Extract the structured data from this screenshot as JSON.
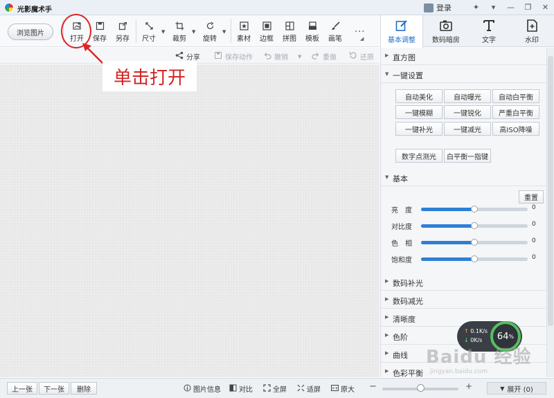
{
  "app": {
    "title": "光影魔术手",
    "login": "登录"
  },
  "toolbar": {
    "browse_label": "浏览图片",
    "tools": [
      {
        "name": "open",
        "label": "打开",
        "icon": "open-image-icon"
      },
      {
        "name": "save",
        "label": "保存",
        "icon": "save-icon"
      },
      {
        "name": "save-as",
        "label": "另存",
        "icon": "save-as-icon"
      },
      {
        "name": "size",
        "label": "尺寸",
        "icon": "resize-icon"
      },
      {
        "name": "crop",
        "label": "裁剪",
        "icon": "crop-icon"
      },
      {
        "name": "rotate",
        "label": "旋转",
        "icon": "rotate-icon"
      },
      {
        "name": "material",
        "label": "素材",
        "icon": "star-frame-icon"
      },
      {
        "name": "border",
        "label": "边框",
        "icon": "border-icon"
      },
      {
        "name": "collage",
        "label": "拼图",
        "icon": "collage-icon"
      },
      {
        "name": "template",
        "label": "模板",
        "icon": "template-icon"
      },
      {
        "name": "brush",
        "label": "画笔",
        "icon": "brush-icon"
      }
    ],
    "more": "..."
  },
  "subbar": {
    "share": "分享",
    "save_action": "保存动作",
    "undo": "撤销",
    "redo": "重做",
    "restore": "还原"
  },
  "annotation": {
    "label": "单击打开",
    "color": "#e02424"
  },
  "right_tabs": [
    {
      "label": "基本调整",
      "icon": "edit-icon",
      "active": true
    },
    {
      "label": "数码暗房",
      "icon": "camera-icon",
      "active": false
    },
    {
      "label": "文字",
      "icon": "text-icon",
      "active": false
    },
    {
      "label": "水印",
      "icon": "watermark-icon",
      "active": false
    }
  ],
  "panel": {
    "histogram": "直方图",
    "one_key": {
      "title": "一键设置",
      "buttons": [
        "自动美化",
        "自动曝光",
        "自动白平衡",
        "一键模糊",
        "一键锐化",
        "严重白平衡",
        "一键补光",
        "一键减光",
        "高ISO降噪"
      ],
      "extra_buttons": [
        "数字点测光",
        "白平衡一指键"
      ]
    },
    "basic": {
      "title": "基本",
      "reset": "重置",
      "sliders": [
        {
          "label": "亮　度",
          "value": "0",
          "level": 0.5
        },
        {
          "label": "对比度",
          "value": "0",
          "level": 0.5
        },
        {
          "label": "色　相",
          "value": "0",
          "level": 0.5
        },
        {
          "label": "饱和度",
          "value": "0",
          "level": 0.5
        }
      ]
    },
    "collapsed_sections": [
      "数码补光",
      "数码减光",
      "清晰度",
      "色阶",
      "曲线",
      "色彩平衡"
    ]
  },
  "statusbar": {
    "prev": "上一张",
    "next": "下一张",
    "delete": "删除",
    "info": "图片信息",
    "compare": "对比",
    "fullscreen": "全屏",
    "fit": "适屏",
    "original": "原大",
    "minus": "−",
    "plus": "+",
    "zoom_level": 0.5,
    "expand": "展开 (0)"
  },
  "speed_widget": {
    "up": "0.1K/s",
    "down": "0K/s",
    "percent": "64",
    "percent_sign": "%"
  },
  "watermark": {
    "text": "Baidu 经验",
    "sub": "jingyan.baidu.com"
  },
  "colors": {
    "accent": "#2d7fd6",
    "tab_active": "#1e6fc6",
    "annotation": "#e02424"
  }
}
